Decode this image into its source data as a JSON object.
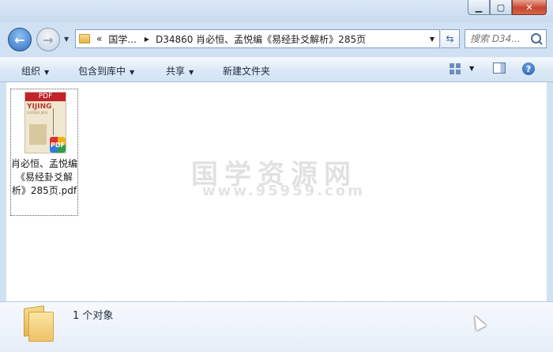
{
  "window": {
    "controls": [
      "minimize",
      "maximize",
      "close"
    ]
  },
  "nav": {
    "back_icon": "arrow-left-icon",
    "forward_icon": "arrow-right-icon"
  },
  "address": {
    "overflow": "«",
    "crumb1": "国学...",
    "crumb2": "D34860 肖必恒、孟悦编《易经卦爻解析》285页"
  },
  "search": {
    "placeholder": "搜索 D34..."
  },
  "toolbar": {
    "organize": "组织",
    "include_library": "包含到库中",
    "share": "共享",
    "new_folder": "新建文件夹"
  },
  "file": {
    "name": "肖必恒、孟悦编《易经卦爻解析》285页.pdf",
    "thumb_pdf_label": "PDF",
    "thumb_title": "YIJING",
    "thumb_sub": "GUAYAO JIEXI",
    "badge": "PDF"
  },
  "watermark": {
    "text": "国学资源网",
    "url": "www.95959.com"
  },
  "status": {
    "count": "1 个对象"
  },
  "colors": {
    "frame": "#cfe1f3",
    "accent": "#2f6fc0",
    "pdf_red": "#c3222a"
  }
}
